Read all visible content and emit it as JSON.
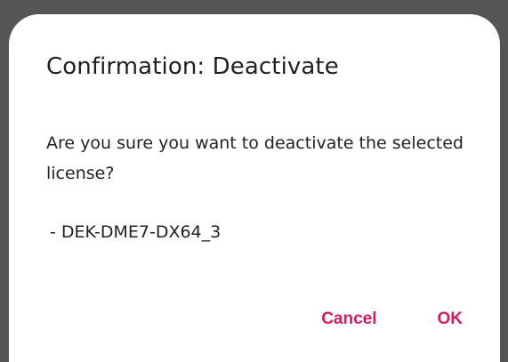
{
  "dialog": {
    "title": "Confirmation: Deactivate",
    "message": "Are you sure you want to deactivate the selected license?",
    "license": "- DEK-DME7-DX64_3",
    "cancel_label": "Cancel",
    "ok_label": "OK",
    "accent_color": "#d81b60"
  }
}
